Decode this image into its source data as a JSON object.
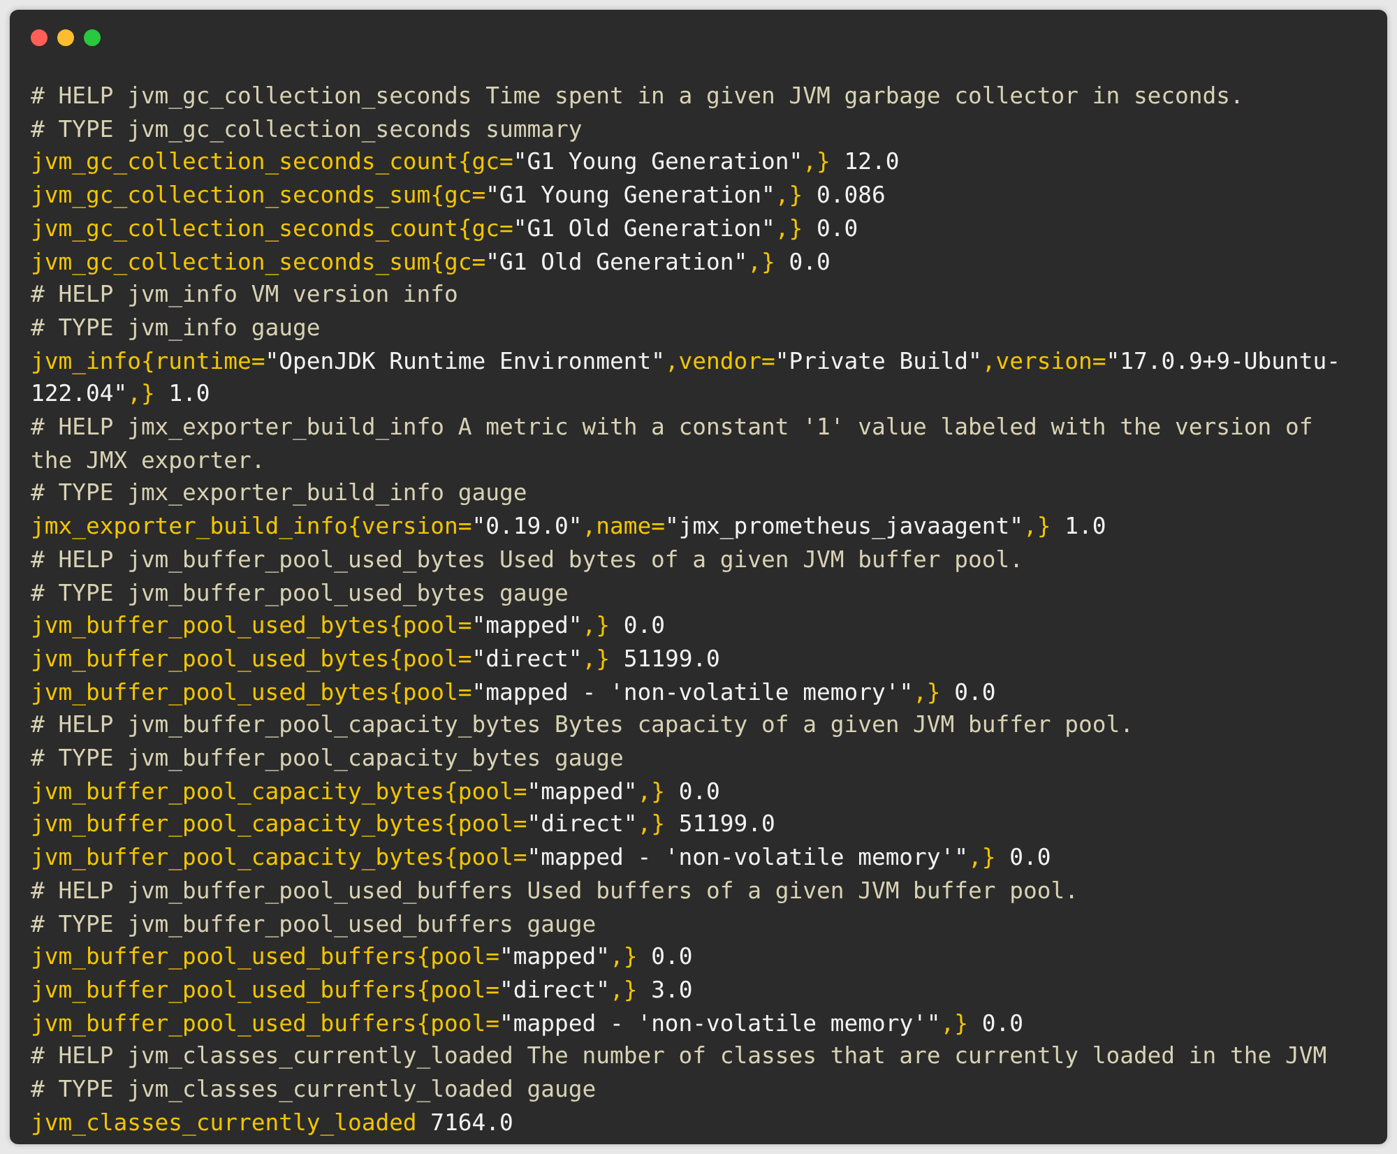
{
  "window": {
    "lines": [
      {
        "kind": "comment",
        "text": "# HELP jvm_gc_collection_seconds Time spent in a given JVM garbage collector in seconds."
      },
      {
        "kind": "comment",
        "text": "# TYPE jvm_gc_collection_seconds summary"
      },
      {
        "kind": "metric",
        "tokens": [
          {
            "kind": "name",
            "text": "jvm_gc_collection_seconds_count{gc="
          },
          {
            "kind": "value",
            "text": "\"G1 Young Generation\""
          },
          {
            "kind": "name",
            "text": ",}"
          },
          {
            "kind": "value",
            "text": " 12.0"
          }
        ]
      },
      {
        "kind": "metric",
        "tokens": [
          {
            "kind": "name",
            "text": "jvm_gc_collection_seconds_sum{gc="
          },
          {
            "kind": "value",
            "text": "\"G1 Young Generation\""
          },
          {
            "kind": "name",
            "text": ",}"
          },
          {
            "kind": "value",
            "text": " 0.086"
          }
        ]
      },
      {
        "kind": "metric",
        "tokens": [
          {
            "kind": "name",
            "text": "jvm_gc_collection_seconds_count{gc="
          },
          {
            "kind": "value",
            "text": "\"G1 Old Generation\""
          },
          {
            "kind": "name",
            "text": ",}"
          },
          {
            "kind": "value",
            "text": " 0.0"
          }
        ]
      },
      {
        "kind": "metric",
        "tokens": [
          {
            "kind": "name",
            "text": "jvm_gc_collection_seconds_sum{gc="
          },
          {
            "kind": "value",
            "text": "\"G1 Old Generation\""
          },
          {
            "kind": "name",
            "text": ",}"
          },
          {
            "kind": "value",
            "text": " 0.0"
          }
        ]
      },
      {
        "kind": "comment",
        "text": "# HELP jvm_info VM version info"
      },
      {
        "kind": "comment",
        "text": "# TYPE jvm_info gauge"
      },
      {
        "kind": "metric",
        "tokens": [
          {
            "kind": "name",
            "text": "jvm_info{runtime="
          },
          {
            "kind": "value",
            "text": "\"OpenJDK Runtime Environment\""
          },
          {
            "kind": "name",
            "text": ",vendor="
          },
          {
            "kind": "value",
            "text": "\"Private Build\""
          },
          {
            "kind": "name",
            "text": ",version="
          },
          {
            "kind": "value",
            "text": "\"17.0.9+9-Ubuntu-"
          }
        ]
      },
      {
        "kind": "metric",
        "tokens": [
          {
            "kind": "value",
            "text": "122.04\""
          },
          {
            "kind": "name",
            "text": ",}"
          },
          {
            "kind": "value",
            "text": " 1.0"
          }
        ]
      },
      {
        "kind": "comment",
        "text": "# HELP jmx_exporter_build_info A metric with a constant '1' value labeled with the version of"
      },
      {
        "kind": "comment",
        "text": "the JMX exporter."
      },
      {
        "kind": "comment",
        "text": "# TYPE jmx_exporter_build_info gauge"
      },
      {
        "kind": "metric",
        "tokens": [
          {
            "kind": "name",
            "text": "jmx_exporter_build_info{version="
          },
          {
            "kind": "value",
            "text": "\"0.19.0\""
          },
          {
            "kind": "name",
            "text": ",name="
          },
          {
            "kind": "value",
            "text": "\"jmx_prometheus_javaagent\""
          },
          {
            "kind": "name",
            "text": ",}"
          },
          {
            "kind": "value",
            "text": " 1.0"
          }
        ]
      },
      {
        "kind": "comment",
        "text": "# HELP jvm_buffer_pool_used_bytes Used bytes of a given JVM buffer pool."
      },
      {
        "kind": "comment",
        "text": "# TYPE jvm_buffer_pool_used_bytes gauge"
      },
      {
        "kind": "metric",
        "tokens": [
          {
            "kind": "name",
            "text": "jvm_buffer_pool_used_bytes{pool="
          },
          {
            "kind": "value",
            "text": "\"mapped\""
          },
          {
            "kind": "name",
            "text": ",}"
          },
          {
            "kind": "value",
            "text": " 0.0"
          }
        ]
      },
      {
        "kind": "metric",
        "tokens": [
          {
            "kind": "name",
            "text": "jvm_buffer_pool_used_bytes{pool="
          },
          {
            "kind": "value",
            "text": "\"direct\""
          },
          {
            "kind": "name",
            "text": ",}"
          },
          {
            "kind": "value",
            "text": " 51199.0"
          }
        ]
      },
      {
        "kind": "metric",
        "tokens": [
          {
            "kind": "name",
            "text": "jvm_buffer_pool_used_bytes{pool="
          },
          {
            "kind": "value",
            "text": "\"mapped - 'non-volatile memory'\""
          },
          {
            "kind": "name",
            "text": ",}"
          },
          {
            "kind": "value",
            "text": " 0.0"
          }
        ]
      },
      {
        "kind": "comment",
        "text": "# HELP jvm_buffer_pool_capacity_bytes Bytes capacity of a given JVM buffer pool."
      },
      {
        "kind": "comment",
        "text": "# TYPE jvm_buffer_pool_capacity_bytes gauge"
      },
      {
        "kind": "metric",
        "tokens": [
          {
            "kind": "name",
            "text": "jvm_buffer_pool_capacity_bytes{pool="
          },
          {
            "kind": "value",
            "text": "\"mapped\""
          },
          {
            "kind": "name",
            "text": ",}"
          },
          {
            "kind": "value",
            "text": " 0.0"
          }
        ]
      },
      {
        "kind": "metric",
        "tokens": [
          {
            "kind": "name",
            "text": "jvm_buffer_pool_capacity_bytes{pool="
          },
          {
            "kind": "value",
            "text": "\"direct\""
          },
          {
            "kind": "name",
            "text": ",}"
          },
          {
            "kind": "value",
            "text": " 51199.0"
          }
        ]
      },
      {
        "kind": "metric",
        "tokens": [
          {
            "kind": "name",
            "text": "jvm_buffer_pool_capacity_bytes{pool="
          },
          {
            "kind": "value",
            "text": "\"mapped - 'non-volatile memory'\""
          },
          {
            "kind": "name",
            "text": ",}"
          },
          {
            "kind": "value",
            "text": " 0.0"
          }
        ]
      },
      {
        "kind": "comment",
        "text": "# HELP jvm_buffer_pool_used_buffers Used buffers of a given JVM buffer pool."
      },
      {
        "kind": "comment",
        "text": "# TYPE jvm_buffer_pool_used_buffers gauge"
      },
      {
        "kind": "metric",
        "tokens": [
          {
            "kind": "name",
            "text": "jvm_buffer_pool_used_buffers{pool="
          },
          {
            "kind": "value",
            "text": "\"mapped\""
          },
          {
            "kind": "name",
            "text": ",}"
          },
          {
            "kind": "value",
            "text": " 0.0"
          }
        ]
      },
      {
        "kind": "metric",
        "tokens": [
          {
            "kind": "name",
            "text": "jvm_buffer_pool_used_buffers{pool="
          },
          {
            "kind": "value",
            "text": "\"direct\""
          },
          {
            "kind": "name",
            "text": ",}"
          },
          {
            "kind": "value",
            "text": " 3.0"
          }
        ]
      },
      {
        "kind": "metric",
        "tokens": [
          {
            "kind": "name",
            "text": "jvm_buffer_pool_used_buffers{pool="
          },
          {
            "kind": "value",
            "text": "\"mapped - 'non-volatile memory'\""
          },
          {
            "kind": "name",
            "text": ",}"
          },
          {
            "kind": "value",
            "text": " 0.0"
          }
        ]
      },
      {
        "kind": "comment",
        "text": "# HELP jvm_classes_currently_loaded The number of classes that are currently loaded in the JVM"
      },
      {
        "kind": "comment",
        "text": "# TYPE jvm_classes_currently_loaded gauge"
      },
      {
        "kind": "metric",
        "tokens": [
          {
            "kind": "name",
            "text": "jvm_classes_currently_loaded"
          },
          {
            "kind": "value",
            "text": " 7164.0"
          }
        ]
      }
    ]
  }
}
